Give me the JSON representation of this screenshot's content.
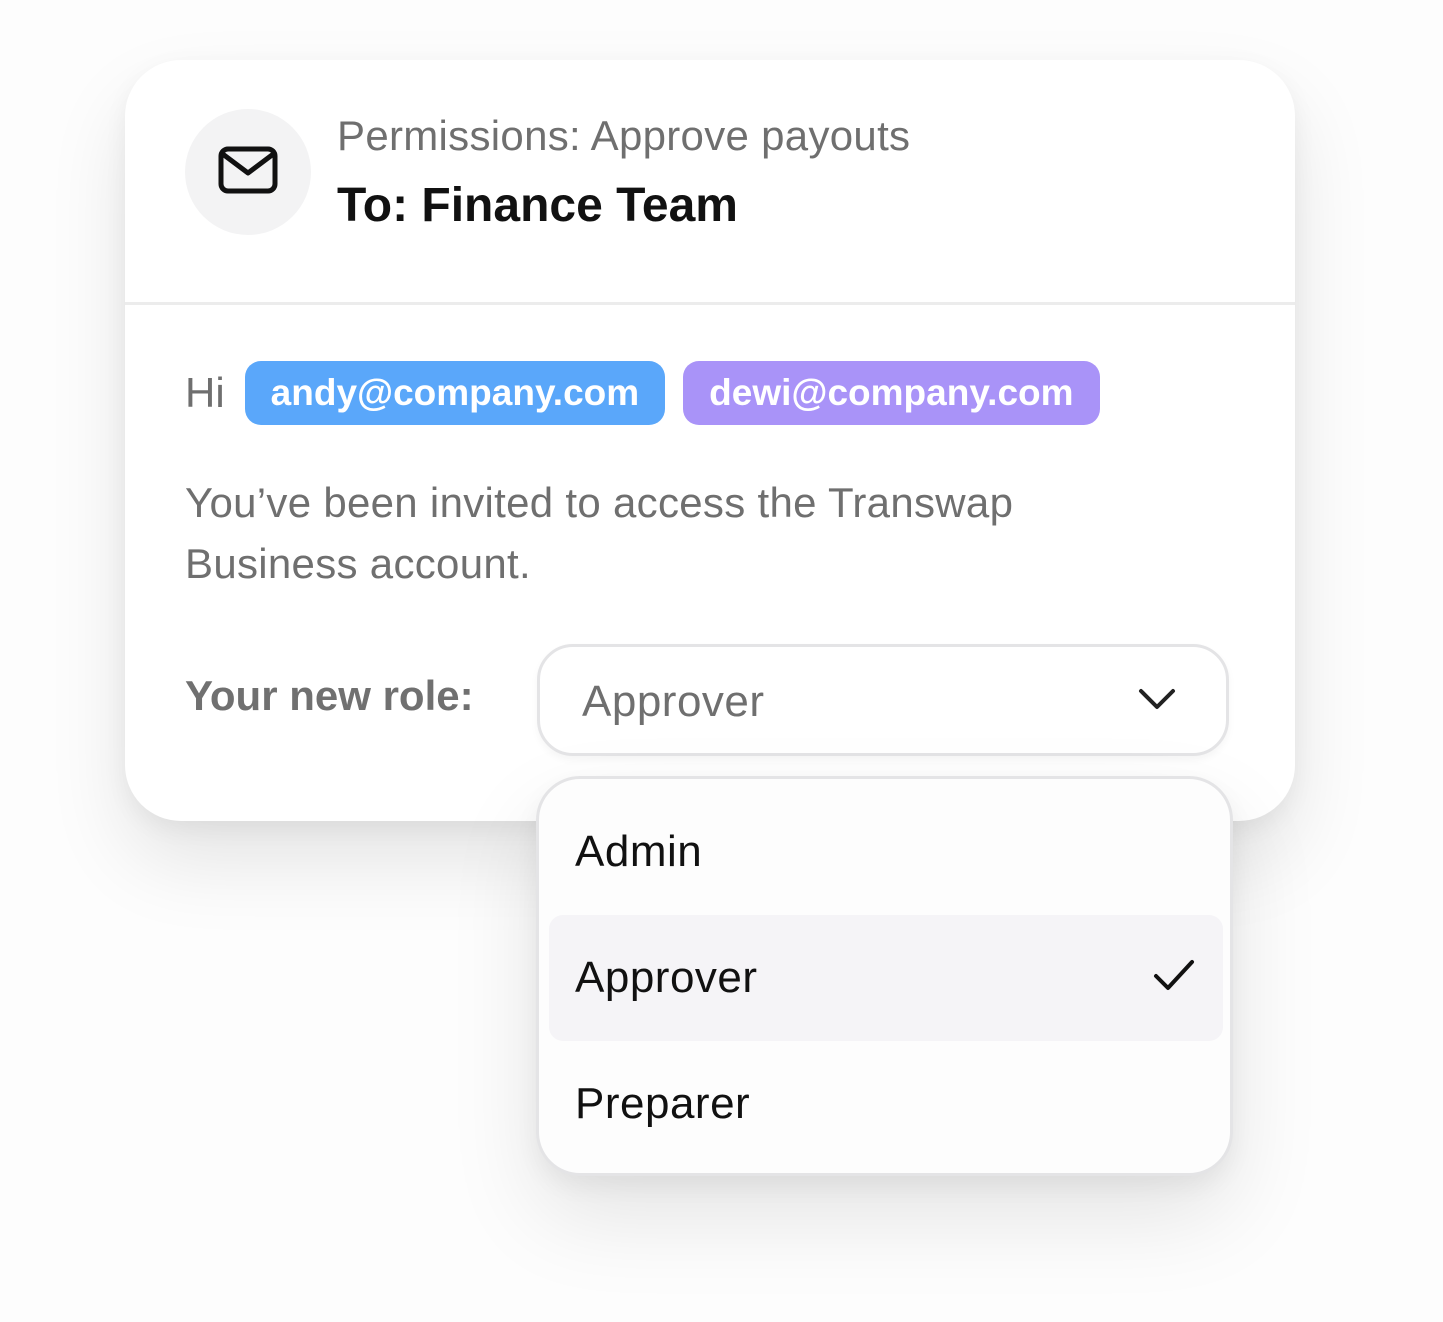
{
  "email": {
    "icon": "mail-icon",
    "subject": "Permissions: Approve payouts",
    "to": "To: Finance Team",
    "greeting": "Hi",
    "recipients": [
      {
        "email": "andy@company.com",
        "color": "#5aa7fa"
      },
      {
        "email": "dewi@company.com",
        "color": "#a993f8"
      }
    ],
    "message": "You’ve been invited to access the Transwap Business account."
  },
  "role": {
    "label": "Your new role:",
    "selected": "Approver",
    "options": [
      {
        "label": "Admin",
        "selected": false
      },
      {
        "label": "Approver",
        "selected": true
      },
      {
        "label": "Preparer",
        "selected": false
      }
    ]
  }
}
